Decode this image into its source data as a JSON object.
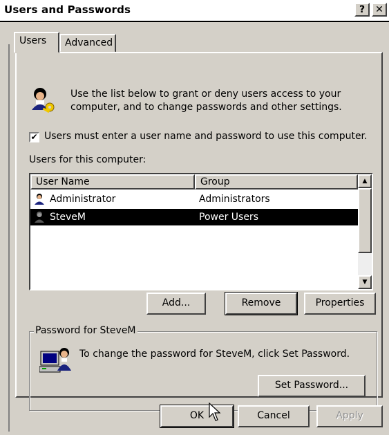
{
  "window": {
    "title": "Users and Passwords",
    "help_label": "?",
    "close_label": "✕"
  },
  "tabs": [
    {
      "label": "Users",
      "active": true
    },
    {
      "label": "Advanced",
      "active": false
    }
  ],
  "intro_text": "Use the list below to grant or deny users access to your computer, and to change passwords and other settings.",
  "require_login": {
    "label": "Users must enter a user name and password to use this computer.",
    "checked": true
  },
  "users_list_label": "Users for this computer:",
  "users_table": {
    "columns": [
      "User Name",
      "Group"
    ],
    "rows": [
      {
        "name": "Administrator",
        "group": "Administrators",
        "selected": false
      },
      {
        "name": "SteveM",
        "group": "Power Users",
        "selected": true
      }
    ]
  },
  "list_buttons": {
    "add": "Add...",
    "remove": "Remove",
    "properties": "Properties"
  },
  "password_group": {
    "title": "Password for SteveM",
    "text": "To change the password for SteveM, click Set Password.",
    "set_password": "Set Password..."
  },
  "footer_buttons": {
    "ok": "OK",
    "cancel": "Cancel",
    "apply": "Apply"
  },
  "icons": {
    "users_icon": "users-keys-icon",
    "user_row_icon": "user-icon",
    "password_icon": "computer-user-icon",
    "cursor": "mouse-pointer-icon"
  }
}
